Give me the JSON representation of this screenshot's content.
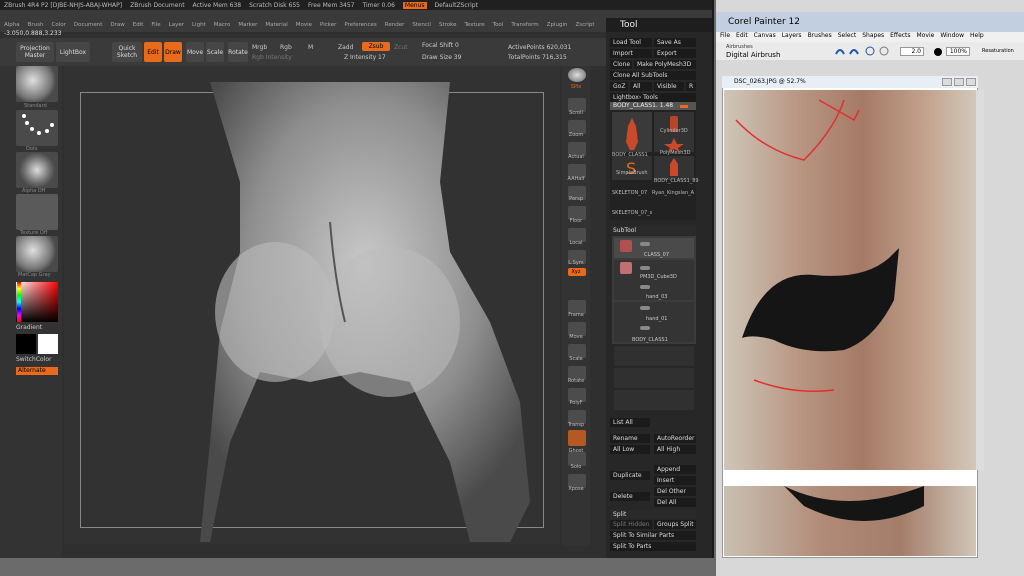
{
  "zbrush": {
    "title_bar": {
      "app": "ZBrush 4R4 P2 [DJBE-NHJS-ABAJ-WHAP]",
      "doc": "ZBrush Document",
      "active_mem": "Active Mem 638",
      "scratch": "Scratch Disk 655",
      "free_mem": "Free Mem 3457",
      "timer": "Timer 0.06",
      "menus_btn": "Menus",
      "script": "DefaultZScript"
    },
    "menu_items": [
      "Alpha",
      "Brush",
      "Color",
      "Document",
      "Draw",
      "Edit",
      "File",
      "Layer",
      "Light",
      "Macro",
      "Marker",
      "Material",
      "Movie",
      "Picker",
      "Preferences",
      "Render",
      "Stencil",
      "Stroke",
      "Texture",
      "Tool",
      "Transform",
      "Zplugin",
      "Zscript"
    ],
    "coords": "-3.050,0.888,3.233",
    "shelf": {
      "projection_master": "Projection Master",
      "lightbox": "LightBox",
      "quick_sketch": "Quick Sketch",
      "edit": "Edit",
      "draw": "Draw",
      "move": "Move",
      "scale": "Scale",
      "rotate": "Rotate",
      "mrgb": "Mrgb",
      "rgb": "Rgb",
      "m": "M",
      "rgb_intensity": "Rgb Intensity",
      "zadd": "Zadd",
      "zsub": "Zsub",
      "zcut": "Zcut",
      "z_intensity": "Z Intensity 17",
      "focal_shift": "Focal Shift 0",
      "draw_size": "Draw Size 39",
      "active_points": "ActivePoints 620,031",
      "total_points": "TotalPoints 716,315"
    },
    "left_tray": {
      "brush_label": "Standard",
      "stroke_label": "Dots",
      "alpha_label": "Alpha Off",
      "texture_label": "Texture Off",
      "material_label": "MatCap Gray",
      "gradient": "Gradient",
      "switch_color": "SwitchColor",
      "alternate": "Alternate"
    },
    "right_tray": [
      "SPix",
      "Scroll",
      "Zoom",
      "Actual",
      "AAHalf",
      "Persp",
      "Floor",
      "Local",
      "L.Sym",
      "Xyz",
      "Frame",
      "Move",
      "Scale",
      "Rotate",
      "PolyF",
      "Transp",
      "Ghost",
      "Solo",
      "Xpose"
    ],
    "tool_panel": {
      "title": "Tool",
      "load_tool": "Load Tool",
      "save_as": "Save As",
      "import": "Import",
      "export": "Export",
      "clone": "Clone",
      "make_polymesh": "Make PolyMesh3D",
      "clone_all": "Clone All SubTools",
      "goz": "GoZ",
      "all": "All",
      "visible": "Visible",
      "r": "R",
      "lightbox_tools": "Lightbox› Tools",
      "current_tool": "BODY_CLASS1. 1.48",
      "tools": [
        "BODY_CLASS1",
        "Cylinder3D",
        "PolyMesh3D",
        "SimpleBrush",
        "BODY_CLASS1_89",
        "SKELETON_07",
        "Ryan_Kingslan_A",
        "SKELETON_07_s"
      ],
      "subtool_header": "SubTool",
      "subtools": [
        "CLASS_07",
        "PM3D_Cube3D",
        "hand_03",
        "hand_01",
        "BODY_CLASS1"
      ],
      "list_all": "List All",
      "rename": "Rename",
      "auto_reorder": "AutoReorder",
      "all_low": "All Low",
      "all_high": "All High",
      "duplicate": "Duplicate",
      "append": "Append",
      "insert": "Insert",
      "delete": "Delete",
      "del_other": "Del Other",
      "del_all": "Del All",
      "split": "Split",
      "split_hidden": "Split Hidden",
      "groups_split": "Groups Split",
      "split_similar": "Split To Similar Parts",
      "split_parts": "Split To Parts"
    }
  },
  "corel": {
    "title": "Corel Painter 12",
    "menus": [
      "File",
      "Edit",
      "Canvas",
      "Layers",
      "Brushes",
      "Select",
      "Shapes",
      "Effects",
      "Movie",
      "Window",
      "Help"
    ],
    "brush_category": "Airbrushes",
    "brush_variant": "Digital Airbrush",
    "size_value": "2.0",
    "opacity_value": "100%",
    "resaturation": "Resaturation",
    "document_title": "DSC_0263.JPG @ 52.7%"
  },
  "colors": {
    "accent": "#e96a1a",
    "panel": "#2f2f2f",
    "red_line": "#e03030"
  }
}
